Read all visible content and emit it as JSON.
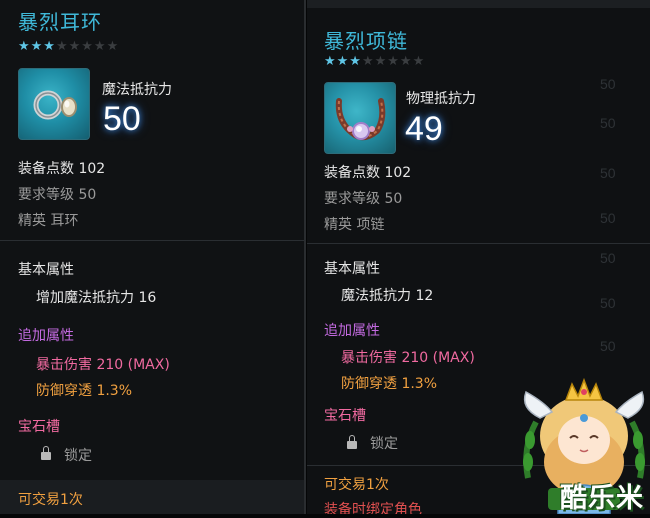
{
  "left_item": {
    "name": "暴烈耳环",
    "stars_filled": 3,
    "stars_total": 8,
    "stat_label": "魔法抵抗力",
    "stat_value": "50",
    "equip_points": "装备点数 102",
    "level_req": "要求等级 50",
    "grade": "精英 耳环",
    "base_header": "基本属性",
    "base_stat": "增加魔法抵抗力 16",
    "extra_header": "追加属性",
    "extra_stats": [
      "暴击伤害 210 (MAX)",
      "防御穿透 1.3%"
    ],
    "gem_header": "宝石槽",
    "gem_slot": "锁定",
    "trade": "可交易1次"
  },
  "right_item": {
    "name": "暴烈项链",
    "stars_filled": 3,
    "stars_total": 8,
    "stat_label": "物理抵抗力",
    "stat_value": "49",
    "equip_points": "装备点数 102",
    "level_req": "要求等级 50",
    "grade": "精英 项链",
    "base_header": "基本属性",
    "base_stat": "魔法抵抗力 12",
    "extra_header": "追加属性",
    "extra_stats": [
      "暴击伤害 210 (MAX)",
      "防御穿透 1.3%"
    ],
    "gem_header": "宝石槽",
    "gem_slot": "锁定",
    "trade": "可交易1次",
    "bind_note": "装备时绑定角色"
  },
  "background_numbers": [
    "50",
    "50",
    "50",
    "50",
    "50",
    "50",
    "50"
  ],
  "watermark": "酷乐米",
  "icons": {
    "earring": "earring-icon",
    "necklace": "necklace-icon",
    "lock": "lock-icon",
    "mascot": "mascot-logo"
  },
  "colors": {
    "title": "#3fb8d8",
    "star_on": "#5fc6e6",
    "extra_header": "#c36ae0",
    "extra_stat_1": "#f06aa0",
    "extra_stat_2": "#f0a040",
    "trade": "#f0a040",
    "bind_note": "#e05050"
  }
}
